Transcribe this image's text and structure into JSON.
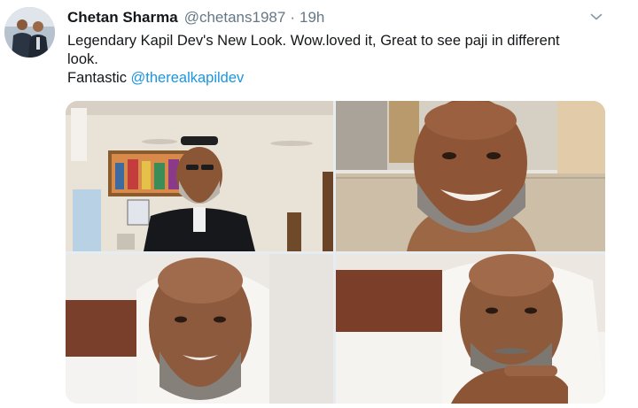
{
  "tweet": {
    "author_name": "Chetan Sharma",
    "author_handle": "@chetans1987",
    "separator": "·",
    "timestamp": "19h",
    "text_line_1": "Legendary Kapil Dev's New Look. Wow.loved it, Great to see paji in different",
    "text_line_2": "look.",
    "text_line_3_prefix": "Fantastic ",
    "mention": "@therealkapildev"
  },
  "icons": {
    "menu": "chevron-down-icon"
  },
  "colors": {
    "text": "#14171a",
    "secondary_text": "#657786",
    "link": "#1b95e0",
    "background": "#ffffff"
  },
  "media": {
    "photo_count": 4
  }
}
